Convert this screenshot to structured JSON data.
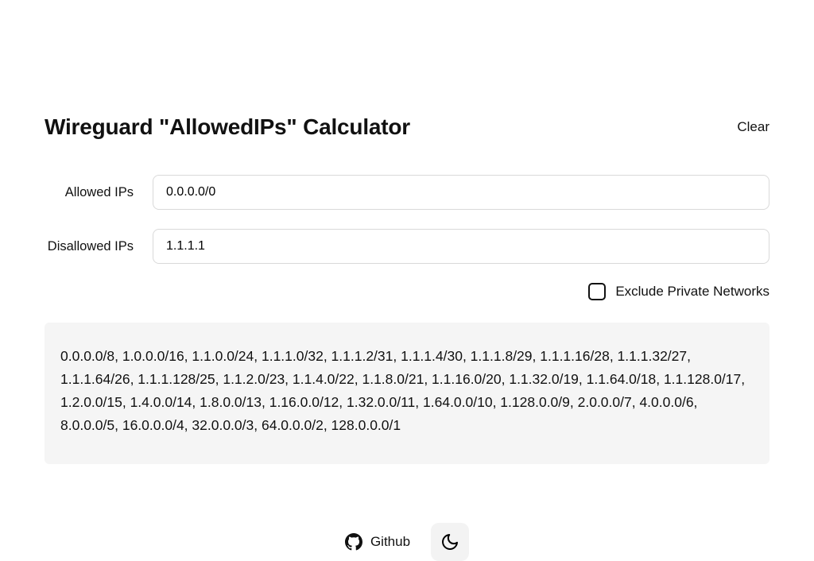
{
  "header": {
    "title": "Wireguard \"AllowedIPs\" Calculator",
    "clear_label": "Clear"
  },
  "form": {
    "allowed_label": "Allowed IPs",
    "allowed_value": "0.0.0.0/0",
    "disallowed_label": "Disallowed IPs",
    "disallowed_value": "1.1.1.1",
    "exclude_private_label": "Exclude Private Networks",
    "exclude_private_checked": false
  },
  "output": {
    "result": "0.0.0.0/8, 1.0.0.0/16, 1.1.0.0/24, 1.1.1.0/32, 1.1.1.2/31, 1.1.1.4/30, 1.1.1.8/29, 1.1.1.16/28, 1.1.1.32/27, 1.1.1.64/26, 1.1.1.128/25, 1.1.2.0/23, 1.1.4.0/22, 1.1.8.0/21, 1.1.16.0/20, 1.1.32.0/19, 1.1.64.0/18, 1.1.128.0/17, 1.2.0.0/15, 1.4.0.0/14, 1.8.0.0/13, 1.16.0.0/12, 1.32.0.0/11, 1.64.0.0/10, 1.128.0.0/9, 2.0.0.0/7, 4.0.0.0/6, 8.0.0.0/5, 16.0.0.0/4, 32.0.0.0/3, 64.0.0.0/2, 128.0.0.0/1"
  },
  "footer": {
    "github_label": "Github"
  }
}
